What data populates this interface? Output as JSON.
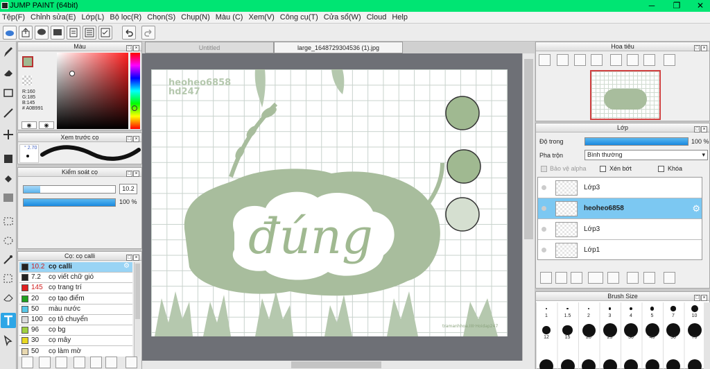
{
  "window": {
    "title": "JUMP PAINT (64bit)"
  },
  "menu": [
    "Tệp(F)",
    "Chỉnh sửa(E)",
    "Lớp(L)",
    "Bộ lọc(R)",
    "Chọn(S)",
    "Chụp(N)",
    "Màu (C)",
    "Xem(V)",
    "Công cụ(T)",
    "Cửa sổ(W)",
    "Cloud",
    "Help"
  ],
  "color_panel": {
    "title": "Màu",
    "r": "R:160",
    "g": "G:185",
    "b": "B:145",
    "hex": "# A0B991",
    "fg": "#a0b991"
  },
  "preview_panel": {
    "title": "Xem trước cọ",
    "size": "2.70"
  },
  "brush_control": {
    "title": "Kiểm soát cọ",
    "size": "10.2",
    "opacity": "100 %",
    "opacity_value": 100
  },
  "brush_list": {
    "title": "Cọ: cọ calli",
    "items": [
      {
        "size": "10.2",
        "name": "cọ calli",
        "color": "#222222"
      },
      {
        "size": "7.2",
        "name": "cọ viết chữ gió",
        "color": "#222222"
      },
      {
        "size": "145",
        "name": "cọ trang trí",
        "color": "#e02020"
      },
      {
        "size": "20",
        "name": "cọ tạo điểm",
        "color": "#20a020"
      },
      {
        "size": "50",
        "name": "màu nước",
        "color": "#58c8e8"
      },
      {
        "size": "100",
        "name": "cọ tô chuyển",
        "color": "#dcdcdc"
      },
      {
        "size": "96",
        "name": "cọ bg",
        "color": "#a0d040"
      },
      {
        "size": "30",
        "name": "cọ mây",
        "color": "#e8d820"
      },
      {
        "size": "50",
        "name": "cọ làm mờ",
        "color": "#e8d8b0"
      }
    ]
  },
  "tabs": [
    {
      "label": "Untitled"
    },
    {
      "label": "large_1648729304536 (1).jpg"
    }
  ],
  "canvas": {
    "watermark_top": "heoheo6858",
    "watermark_top2": "hd247",
    "main_word": "đúng",
    "credit": "tramanhhoa.IIII·Hoidap247"
  },
  "navigator": {
    "title": "Hoa tiêu"
  },
  "layer_panel": {
    "title": "Lớp",
    "opacity_label": "Độ trong",
    "opacity_value": "100 %",
    "opacity_num": 100,
    "blend_label": "Pha trộn",
    "blend_value": "Bình thường",
    "protect_alpha": "Bảo vệ alpha",
    "clipping": "Xén bớt",
    "lock": "Khóa",
    "layers": [
      {
        "name": "Lớp3",
        "selected": false
      },
      {
        "name": "heoheo6858",
        "selected": true
      },
      {
        "name": "Lớp3",
        "selected": false
      },
      {
        "name": "Lớp1",
        "selected": false
      }
    ]
  },
  "brush_size": {
    "title": "Brush Size",
    "row1": [
      "1",
      "1.5",
      "2",
      "3",
      "4",
      "5",
      "7",
      "10"
    ],
    "row2": [
      "12",
      "15",
      "20",
      "25",
      "30",
      "40",
      "50",
      "70"
    ]
  }
}
